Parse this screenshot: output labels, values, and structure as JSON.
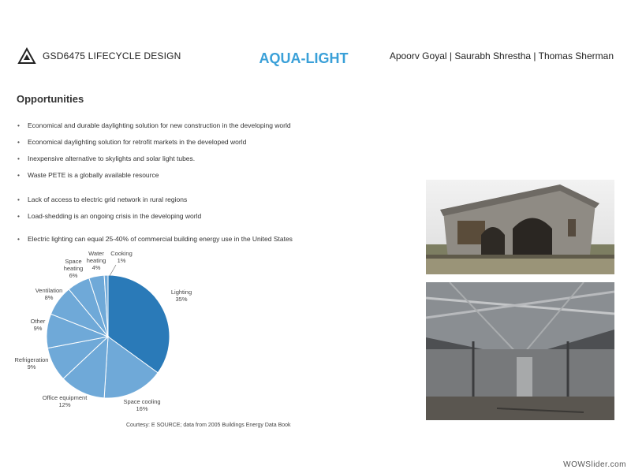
{
  "header": {
    "logo_icon": "recycle-icon",
    "course": "GSD6475 LIFECYCLE DESIGN",
    "title": "AQUA-LIGHT",
    "authors": "Apoorv Goyal | Saurabh Shrestha | Thomas Sherman"
  },
  "section": {
    "heading": "Opportunities",
    "group1": [
      "Economical and durable daylighting solution for  new construction in the developing world",
      "Economical daylighting solution for retrofit markets in the developed world",
      "Inexpensive alternative to skylights and solar light tubes.",
      "Waste PETE is a globally available resource"
    ],
    "group2": [
      "Lack of access to electric grid network in rural regions",
      "Load-shedding  is an ongoing crisis in the developing world"
    ],
    "group3": [
      "Electric lighting can equal 25-40% of commercial building energy use in the United States"
    ]
  },
  "chart_data": {
    "type": "pie",
    "slices": [
      {
        "label": "Lighting",
        "value": 35,
        "color": "#2a7ab8"
      },
      {
        "label": "Space cooling",
        "value": 16,
        "color": "#6fa9d8"
      },
      {
        "label": "Office equipment",
        "value": 12,
        "color": "#6fa9d8"
      },
      {
        "label": "Refrigeration",
        "value": 9,
        "color": "#6fa9d8"
      },
      {
        "label": "Other",
        "value": 9,
        "color": "#6fa9d8"
      },
      {
        "label": "Ventilation",
        "value": 8,
        "color": "#6fa9d8"
      },
      {
        "label": "Space heating",
        "value": 6,
        "color": "#6fa9d8"
      },
      {
        "label": "Water heating",
        "value": 4,
        "color": "#6fa9d8"
      },
      {
        "label": "Cooking",
        "value": 1,
        "color": "#6fa9d8"
      }
    ],
    "value_suffix": "%",
    "courtesy": "Courtesy: E SOURCE; data from 2005 Buildings Energy Data Book"
  },
  "images": {
    "photo_top": "building-exterior-image",
    "photo_bottom": "warehouse-interior-image"
  },
  "watermark": "WOWSlider.com"
}
